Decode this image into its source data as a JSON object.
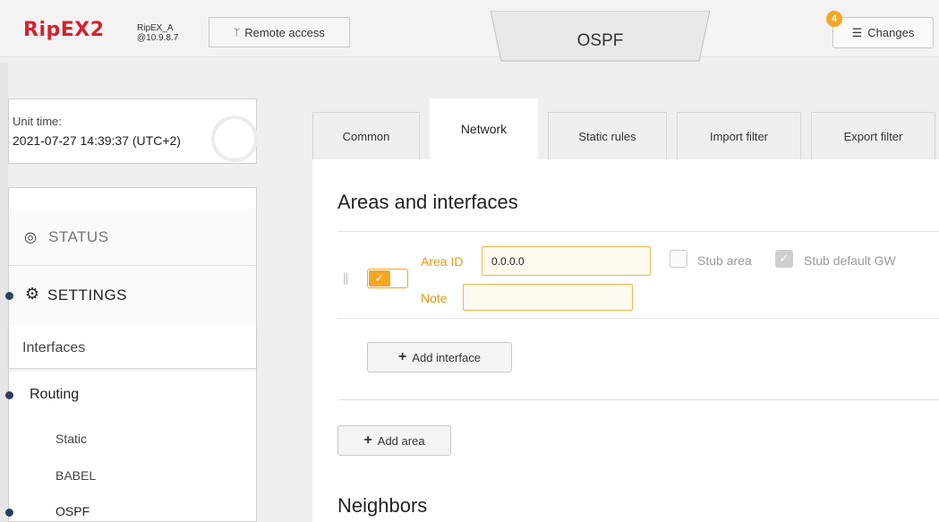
{
  "header": {
    "logo": "RipEX2",
    "device_name": "RipEX_A",
    "device_ip": "@10.9.8.7",
    "remote_access_label": "Remote access",
    "page_title": "OSPF",
    "changes_label": "Changes",
    "changes_count": "4"
  },
  "unit_time": {
    "label": "Unit time:",
    "value": "2021-07-27 14:39:37 (UTC+2)"
  },
  "menu": {
    "status": "STATUS",
    "settings": "SETTINGS",
    "interfaces": "Interfaces",
    "routing": "Routing",
    "static": "Static",
    "babel": "BABEL",
    "ospf": "OSPF"
  },
  "tabs": [
    {
      "label": "Common"
    },
    {
      "label": "Network"
    },
    {
      "label": "Static rules"
    },
    {
      "label": "Import filter"
    },
    {
      "label": "Export filter"
    }
  ],
  "areas": {
    "title": "Areas and interfaces",
    "area_id_label": "Area ID",
    "area_id_value": "0.0.0.0",
    "note_label": "Note",
    "note_value": "",
    "stub_area_label": "Stub area",
    "stub_default_gw_label": "Stub default GW",
    "add_interface_label": "Add interface",
    "add_area_label": "Add area"
  },
  "neighbors": {
    "title": "Neighbors"
  },
  "colors": {
    "brand_red": "#d1242f",
    "accent_orange": "#f5a623",
    "nav_dot": "#2f3d5a"
  }
}
